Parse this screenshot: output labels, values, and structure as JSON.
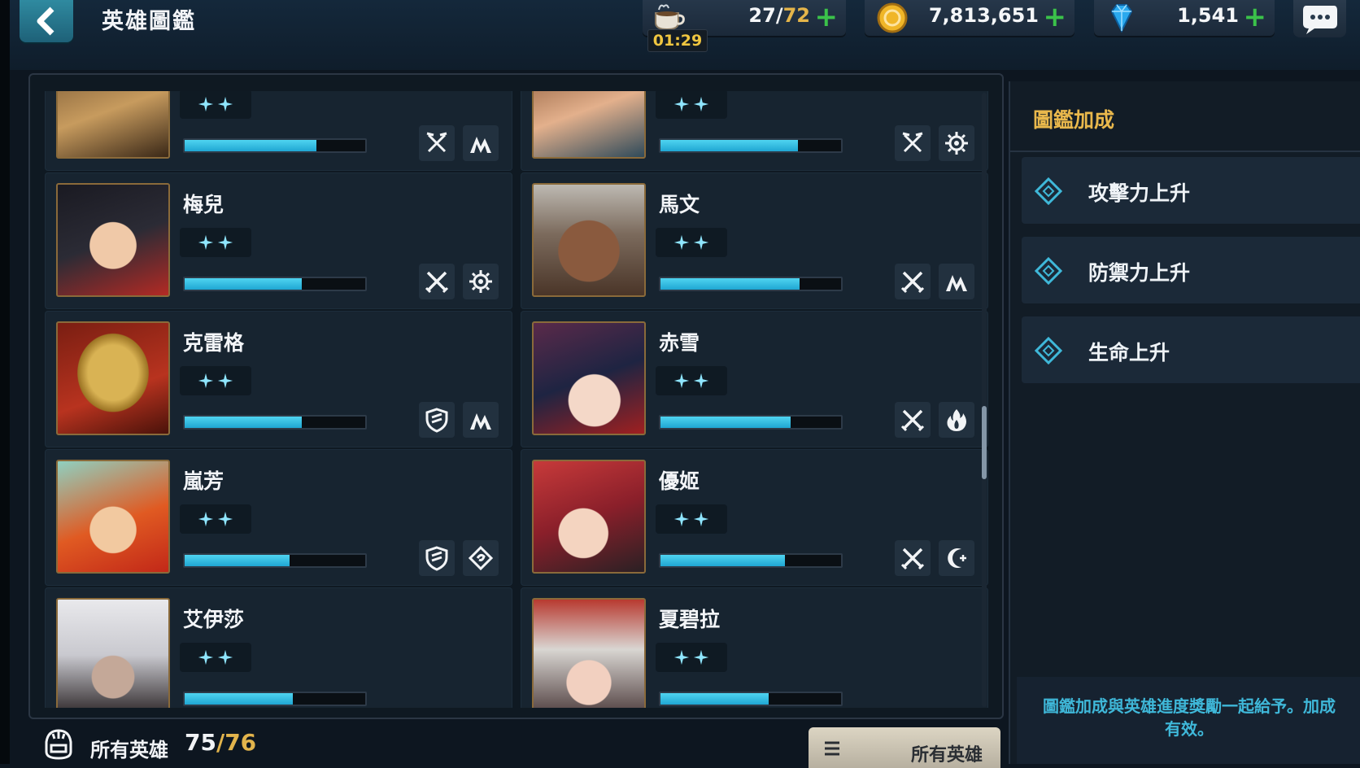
{
  "header": {
    "title": "英雄圖鑑",
    "stamina": {
      "current": "27",
      "max": "72",
      "timer": "01:29"
    },
    "gold": "7,813,651",
    "gems": "1,541"
  },
  "heroes": [
    {
      "name": "",
      "progress": 0.73,
      "icons": [
        "no-attack-icon",
        "mountain-icon"
      ]
    },
    {
      "name": "",
      "progress": 0.76,
      "icons": [
        "no-attack-icon",
        "gear-icon"
      ]
    },
    {
      "name": "梅兒",
      "progress": 0.65,
      "icons": [
        "crossed-swords-icon",
        "gear-icon"
      ]
    },
    {
      "name": "馬文",
      "progress": 0.77,
      "icons": [
        "crossed-swords-icon",
        "mountain-icon"
      ]
    },
    {
      "name": "克雷格",
      "progress": 0.65,
      "icons": [
        "shield-icon",
        "mountain-icon"
      ]
    },
    {
      "name": "赤雪",
      "progress": 0.72,
      "icons": [
        "crossed-swords-icon",
        "fire-icon"
      ]
    },
    {
      "name": "嵐芳",
      "progress": 0.58,
      "icons": [
        "shield-icon",
        "diamond-swirl-icon"
      ]
    },
    {
      "name": "優姬",
      "progress": 0.69,
      "icons": [
        "crossed-swords-icon",
        "crescent-icon"
      ]
    },
    {
      "name": "艾伊莎",
      "progress": 0.6,
      "icons": []
    },
    {
      "name": "夏碧拉",
      "progress": 0.6,
      "icons": []
    }
  ],
  "footer": {
    "all_label": "所有英雄",
    "owned": "75",
    "total": "76",
    "filter_label": "所有英雄"
  },
  "bonus_panel": {
    "title": "圖鑑加成",
    "items": [
      "攻擊力上升",
      "防禦力上升",
      "生命上升"
    ],
    "note_line1": "圖鑑加成與英雄進度獎勵一起給予。加成",
    "note_line2": "有效。"
  },
  "colors": {
    "accent_gold": "#e9b84c",
    "progress_cyan": "#2fb8e0",
    "plus_green": "#3bc24a"
  }
}
